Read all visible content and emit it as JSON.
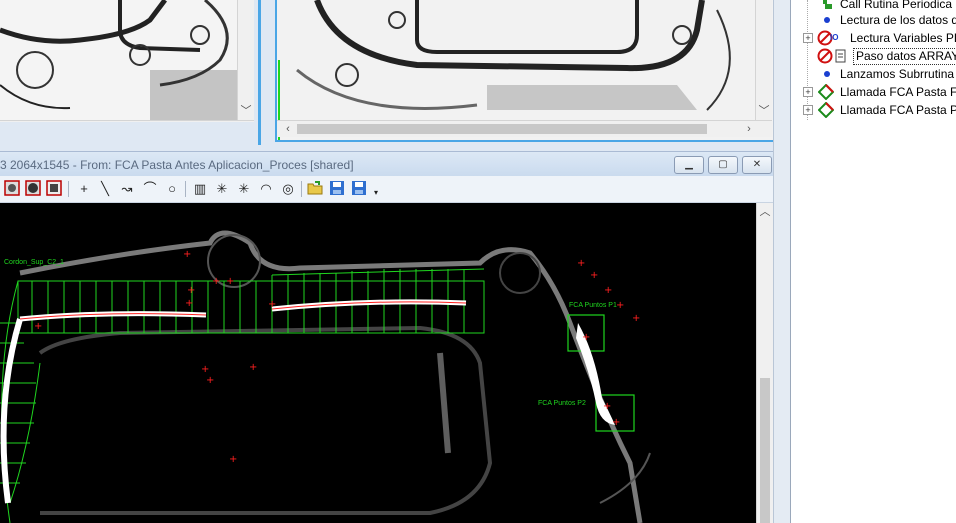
{
  "main_window": {
    "title": "3 2064x1545 - From: FCA Pasta Antes Aplicacion_Proces [shared]",
    "minimize_symbol": "▁",
    "maximize_symbol": "▢",
    "close_symbol": "✕"
  },
  "scroll_arrows": {
    "left": "‹",
    "right": "›",
    "up": "︿",
    "down": "﹀"
  },
  "toolbar": {
    "tools": [
      "+",
      "╲",
      "↝",
      "⌒",
      "○",
      "▥",
      "✳",
      "✳",
      "◠",
      "◎"
    ]
  },
  "overlay_labels": {
    "cordon": "Cordon_Sup_C2_1",
    "puntos1": "FCA Puntos P1",
    "puntos2": "FCA Puntos P2"
  },
  "tree": {
    "items": [
      {
        "label": "Call Rutina Periodica P",
        "icon": "green-arrow-icon",
        "expandable": false
      },
      {
        "label": "Lectura de los datos q",
        "icon": "blue-dot-icon",
        "expandable": false
      },
      {
        "label": "Lectura Variables PL",
        "icon": "io-read-icon",
        "expandable": true
      },
      {
        "label": "Paso datos ARRAY I",
        "icon": "disabled-step-icon",
        "expandable": false
      },
      {
        "label": "Lanzamos Subrrutina c",
        "icon": "blue-dot-icon",
        "expandable": false
      },
      {
        "label": "Llamada FCA Pasta Fo",
        "icon": "diamond-icon",
        "expandable": true
      },
      {
        "label": "Llamada FCA Pasta Pro",
        "icon": "diamond-icon",
        "expandable": true
      }
    ]
  },
  "colors": {
    "overlay_green": "#1fd61f",
    "overlay_red": "#ff2020",
    "title_text": "#5a6a80"
  }
}
